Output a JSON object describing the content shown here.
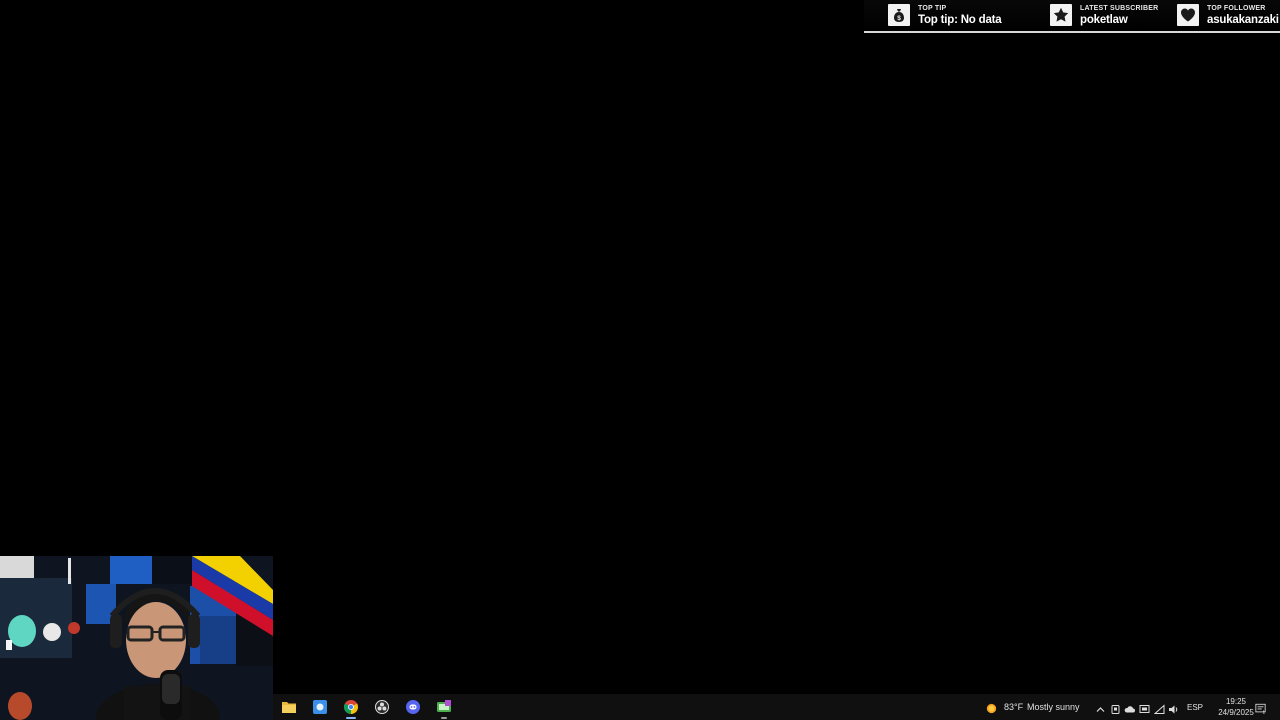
{
  "overlay": {
    "top_tip": {
      "label": "TOP TIP",
      "value": "Top tip: No data",
      "icon": "money-bag-icon"
    },
    "latest_subscriber": {
      "label": "LATEST SUBSCRIBER",
      "value": "poketlaw",
      "icon": "star-icon"
    },
    "top_follower": {
      "label": "TOP FOLLOWER",
      "value": "asukakanzaki",
      "icon": "heart-icon"
    }
  },
  "taskbar": {
    "apps": [
      {
        "name": "file-explorer",
        "icon": "folder-icon"
      },
      {
        "name": "store",
        "icon": "store-icon"
      },
      {
        "name": "chrome",
        "icon": "chrome-icon",
        "state": "active"
      },
      {
        "name": "obs",
        "icon": "obs-icon"
      },
      {
        "name": "discord",
        "icon": "discord-icon"
      },
      {
        "name": "app",
        "icon": "app-icon"
      }
    ],
    "weather": {
      "temp": "83°F",
      "condition": "Mostly sunny"
    },
    "language": "ESP",
    "clock": {
      "time": "19:25",
      "date": "24/9/2025"
    }
  },
  "colors": {
    "background": "#000000",
    "taskbar": "#101010",
    "chrome_active": "#8ab4f8"
  }
}
